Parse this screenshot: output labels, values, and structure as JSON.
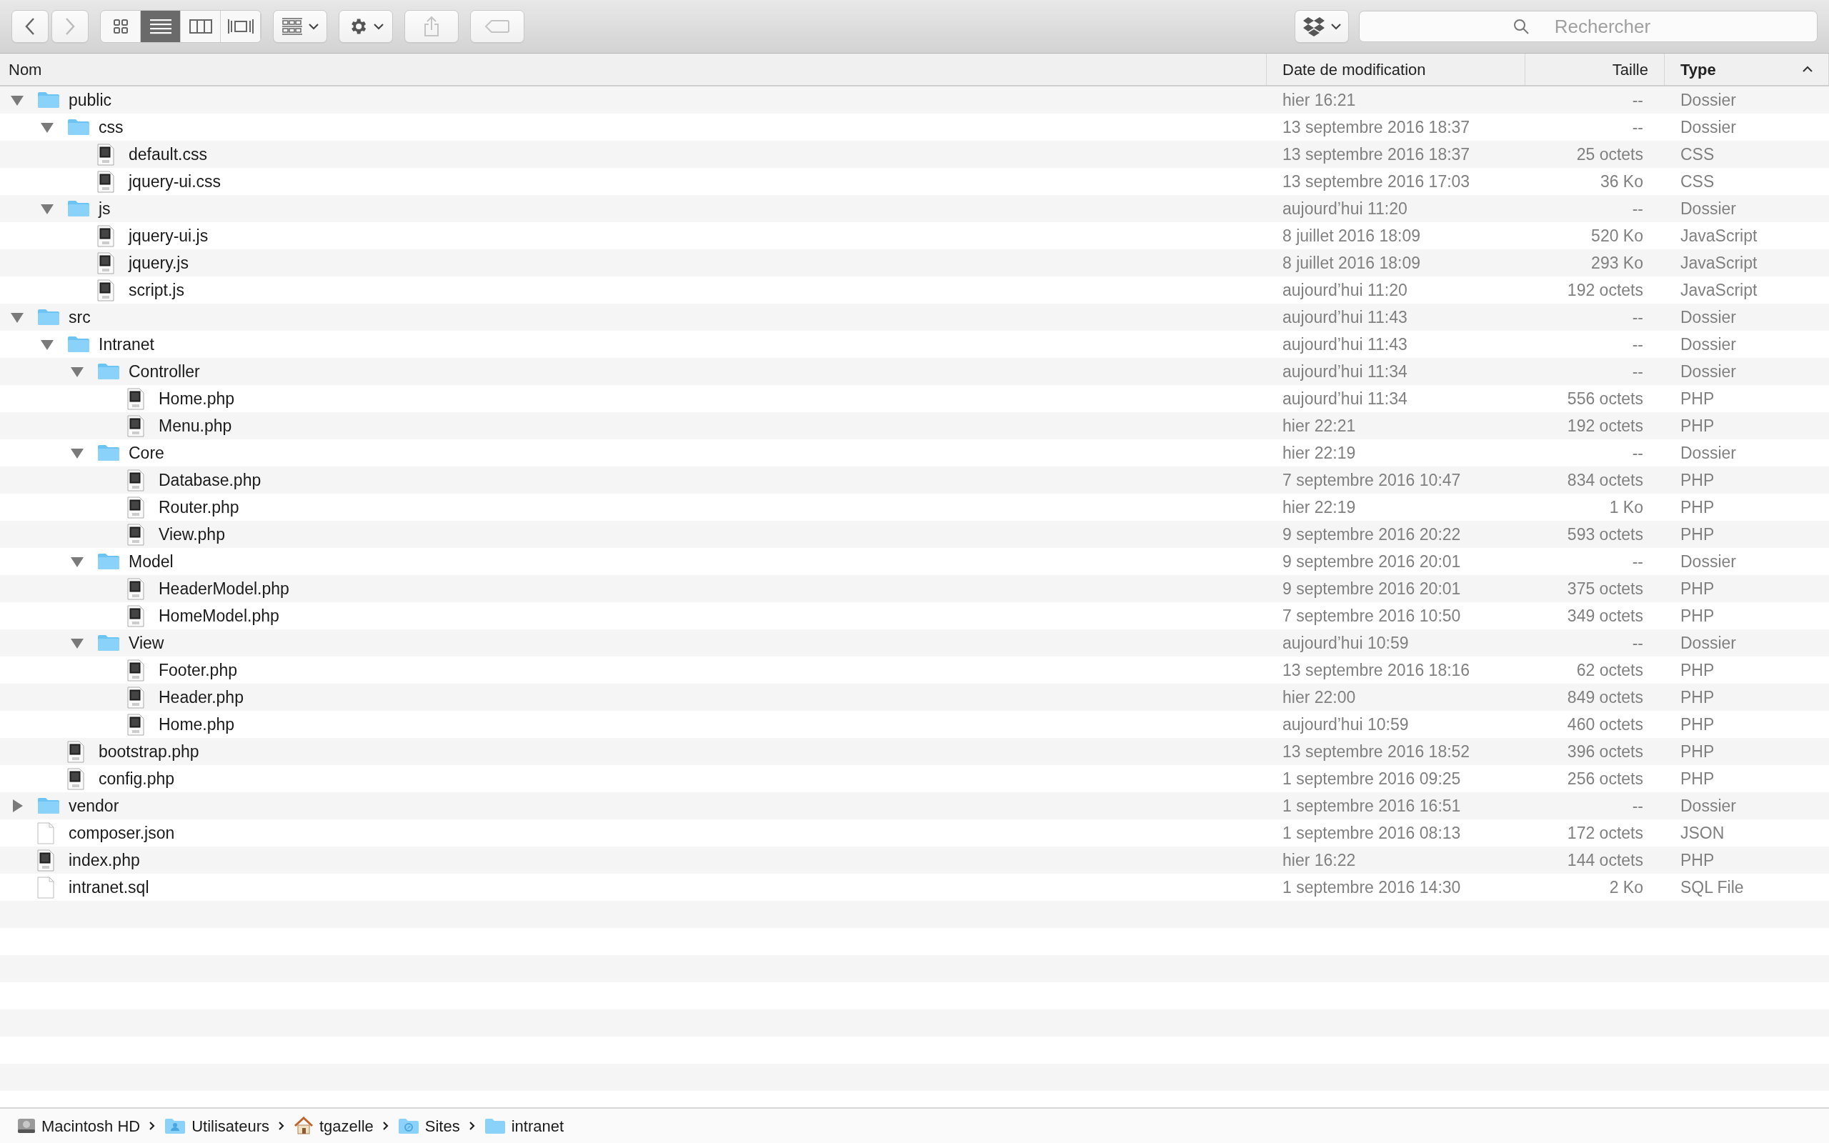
{
  "toolbar": {
    "back": {
      "disabled": false
    },
    "forward": {
      "disabled": true
    },
    "view_modes": [
      {
        "kind": "icons",
        "selected": false
      },
      {
        "kind": "list",
        "selected": true
      },
      {
        "kind": "columns",
        "selected": false
      },
      {
        "kind": "coverflow",
        "selected": false
      }
    ],
    "share": {
      "disabled": true
    },
    "tags": {
      "disabled": true
    },
    "search": {
      "placeholder": "Rechercher"
    }
  },
  "columns": [
    {
      "label": "Nom",
      "sorted": false
    },
    {
      "label": "Date de modification",
      "sorted": false
    },
    {
      "label": "Taille",
      "sorted": false
    },
    {
      "label": "Type",
      "sorted": true
    }
  ],
  "rows": [
    {
      "name": "public",
      "kind": "folder",
      "expanded": true,
      "date": "hier 16:21",
      "size": "--",
      "type": "Dossier",
      "children": [
        {
          "name": "css",
          "kind": "folder",
          "expanded": true,
          "date": "13 septembre 2016 18:37",
          "size": "--",
          "type": "Dossier",
          "children": [
            {
              "name": "default.css",
              "kind": "code-file",
              "date": "13 septembre 2016 18:37",
              "size": "25 octets",
              "type": "CSS"
            },
            {
              "name": "jquery-ui.css",
              "kind": "code-file",
              "date": "13 septembre 2016 17:03",
              "size": "36 Ko",
              "type": "CSS"
            }
          ]
        },
        {
          "name": "js",
          "kind": "folder",
          "expanded": true,
          "date": "aujourd’hui 11:20",
          "size": "--",
          "type": "Dossier",
          "children": [
            {
              "name": "jquery-ui.js",
              "kind": "code-file",
              "date": "8 juillet 2016 18:09",
              "size": "520 Ko",
              "type": "JavaScript"
            },
            {
              "name": "jquery.js",
              "kind": "code-file",
              "date": "8 juillet 2016 18:09",
              "size": "293 Ko",
              "type": "JavaScript"
            },
            {
              "name": "script.js",
              "kind": "code-file",
              "date": "aujourd’hui 11:20",
              "size": "192 octets",
              "type": "JavaScript"
            }
          ]
        }
      ]
    },
    {
      "name": "src",
      "kind": "folder",
      "expanded": true,
      "date": "aujourd’hui 11:43",
      "size": "--",
      "type": "Dossier",
      "children": [
        {
          "name": "Intranet",
          "kind": "folder",
          "expanded": true,
          "date": "aujourd’hui 11:43",
          "size": "--",
          "type": "Dossier",
          "children": [
            {
              "name": "Controller",
              "kind": "folder",
              "expanded": true,
              "date": "aujourd’hui 11:34",
              "size": "--",
              "type": "Dossier",
              "children": [
                {
                  "name": "Home.php",
                  "kind": "code-file",
                  "date": "aujourd’hui 11:34",
                  "size": "556 octets",
                  "type": "PHP"
                },
                {
                  "name": "Menu.php",
                  "kind": "code-file",
                  "date": "hier 22:21",
                  "size": "192 octets",
                  "type": "PHP"
                }
              ]
            },
            {
              "name": "Core",
              "kind": "folder",
              "expanded": true,
              "date": "hier 22:19",
              "size": "--",
              "type": "Dossier",
              "children": [
                {
                  "name": "Database.php",
                  "kind": "code-file",
                  "date": "7 septembre 2016 10:47",
                  "size": "834 octets",
                  "type": "PHP"
                },
                {
                  "name": "Router.php",
                  "kind": "code-file",
                  "date": "hier 22:19",
                  "size": "1 Ko",
                  "type": "PHP"
                },
                {
                  "name": "View.php",
                  "kind": "code-file",
                  "date": "9 septembre 2016 20:22",
                  "size": "593 octets",
                  "type": "PHP"
                }
              ]
            },
            {
              "name": "Model",
              "kind": "folder",
              "expanded": true,
              "date": "9 septembre 2016 20:01",
              "size": "--",
              "type": "Dossier",
              "children": [
                {
                  "name": "HeaderModel.php",
                  "kind": "code-file",
                  "date": "9 septembre 2016 20:01",
                  "size": "375 octets",
                  "type": "PHP"
                },
                {
                  "name": "HomeModel.php",
                  "kind": "code-file",
                  "date": "7 septembre 2016 10:50",
                  "size": "349 octets",
                  "type": "PHP"
                }
              ]
            },
            {
              "name": "View",
              "kind": "folder",
              "expanded": true,
              "date": "aujourd’hui 10:59",
              "size": "--",
              "type": "Dossier",
              "children": [
                {
                  "name": "Footer.php",
                  "kind": "code-file",
                  "date": "13 septembre 2016 18:16",
                  "size": "62 octets",
                  "type": "PHP"
                },
                {
                  "name": "Header.php",
                  "kind": "code-file",
                  "date": "hier 22:00",
                  "size": "849 octets",
                  "type": "PHP"
                },
                {
                  "name": "Home.php",
                  "kind": "code-file",
                  "date": "aujourd’hui 10:59",
                  "size": "460 octets",
                  "type": "PHP"
                }
              ]
            }
          ]
        },
        {
          "name": "bootstrap.php",
          "kind": "code-file",
          "date": "13 septembre 2016 18:52",
          "size": "396 octets",
          "type": "PHP"
        },
        {
          "name": "config.php",
          "kind": "code-file",
          "date": "1 septembre 2016 09:25",
          "size": "256 octets",
          "type": "PHP"
        }
      ]
    },
    {
      "name": "vendor",
      "kind": "folder",
      "expanded": false,
      "date": "1 septembre 2016 16:51",
      "size": "--",
      "type": "Dossier"
    },
    {
      "name": "composer.json",
      "kind": "blank-file",
      "date": "1 septembre 2016 08:13",
      "size": "172 octets",
      "type": "JSON"
    },
    {
      "name": "index.php",
      "kind": "code-file",
      "date": "hier 16:22",
      "size": "144 octets",
      "type": "PHP"
    },
    {
      "name": "intranet.sql",
      "kind": "blank-file",
      "date": "1 septembre 2016 14:30",
      "size": "2 Ko",
      "type": "SQL File"
    }
  ],
  "path_bar": [
    {
      "label": "Macintosh HD",
      "kind": "disk"
    },
    {
      "label": "Utilisateurs",
      "kind": "users-folder"
    },
    {
      "label": "tgazelle",
      "kind": "home"
    },
    {
      "label": "Sites",
      "kind": "sites-folder"
    },
    {
      "label": "intranet",
      "kind": "folder"
    }
  ]
}
